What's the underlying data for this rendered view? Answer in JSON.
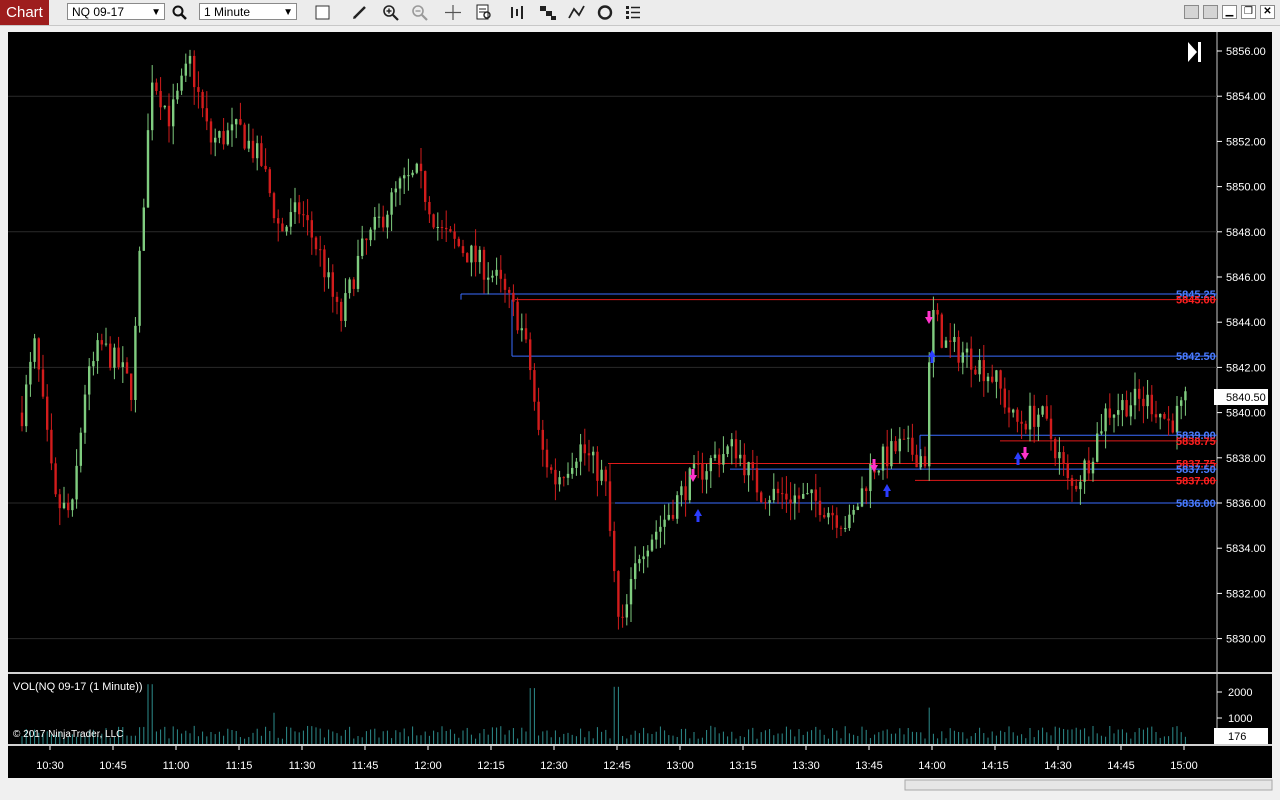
{
  "toolbar": {
    "tab_label": "Chart",
    "instrument": "NQ 09-17",
    "interval": "1 Minute"
  },
  "price_axis": {
    "ticks": [
      "5856.00",
      "5854.00",
      "5852.00",
      "5850.00",
      "5848.00",
      "5846.00",
      "5844.00",
      "5842.00",
      "5840.00",
      "5838.00",
      "5836.00",
      "5834.00",
      "5832.00",
      "5830.00"
    ],
    "current_price": "5840.50"
  },
  "time_axis": {
    "ticks": [
      "10:30",
      "10:45",
      "11:00",
      "11:15",
      "11:30",
      "11:45",
      "12:00",
      "12:15",
      "12:30",
      "12:45",
      "13:00",
      "13:15",
      "13:30",
      "13:45",
      "14:00",
      "14:15",
      "14:30",
      "14:45",
      "15:00"
    ]
  },
  "level_labels": [
    {
      "text": "5845.25",
      "color": "#4a7cff"
    },
    {
      "text": "5845.00",
      "color": "#ff2020"
    },
    {
      "text": "5842.50",
      "color": "#4a7cff"
    },
    {
      "text": "5839.00",
      "color": "#4a7cff"
    },
    {
      "text": "5838.75",
      "color": "#ff2020"
    },
    {
      "text": "5837.75",
      "color": "#ff2020"
    },
    {
      "text": "5837.50",
      "color": "#4a7cff"
    },
    {
      "text": "5837.00",
      "color": "#ff2020"
    },
    {
      "text": "5836.00",
      "color": "#4a7cff"
    }
  ],
  "volume_panel": {
    "label": "VOL(NQ 09-17 (1 Minute))",
    "ticks": [
      "2000",
      "1000"
    ],
    "current_volume": "176",
    "copyright": "© 2017 NinjaTrader, LLC"
  },
  "colors": {
    "up_candle": "#7fcc7f",
    "down_candle": "#d21c1c",
    "volume_bar": "#2d8c8c",
    "background": "#000000",
    "blue_level": "#3a6cff",
    "red_level": "#e01a1a",
    "magenta_marker": "#ff33cc",
    "blue_marker": "#2b3dff"
  }
}
